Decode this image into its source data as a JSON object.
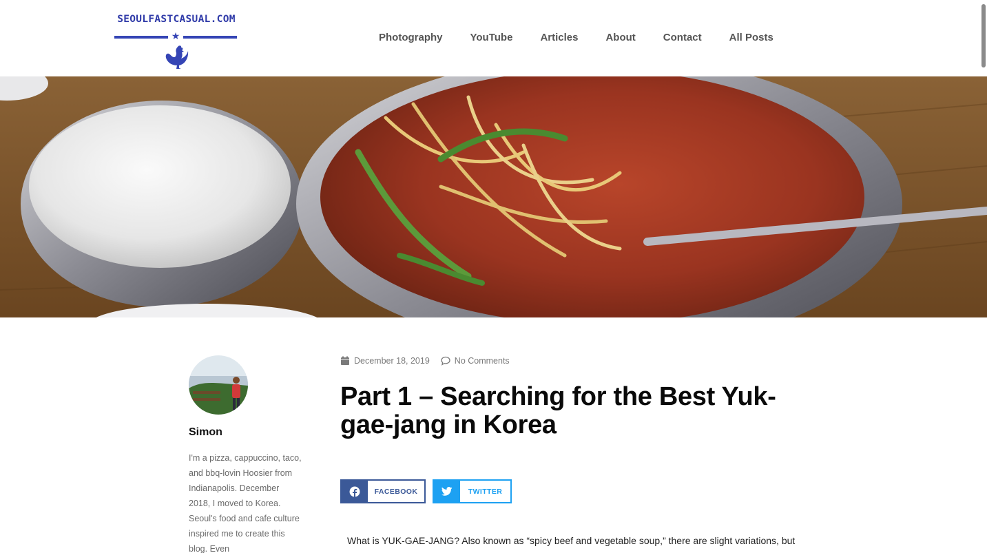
{
  "site": {
    "logo_text": "SEOULFASTCASUAL.COM",
    "brand_color": "#3545b5"
  },
  "nav": {
    "items": [
      {
        "label": "Photography"
      },
      {
        "label": "YouTube"
      },
      {
        "label": "Articles"
      },
      {
        "label": "About"
      },
      {
        "label": "Contact"
      },
      {
        "label": "All Posts"
      }
    ]
  },
  "author": {
    "name": "Simon",
    "bio": "I'm a pizza, cappuccino, taco, and bbq-lovin Hoosier from Indianapolis. December 2018, I moved to Korea. Seoul's food and cafe culture inspired me to create this blog. Even"
  },
  "post": {
    "date": "December 18, 2019",
    "comments": "No Comments",
    "title": "Part 1 – Searching for the Best Yuk-gae-jang in Korea",
    "intro": "What is YUK-GAE-JANG? Also known as “spicy beef and vegetable soup,” there are slight variations, but"
  },
  "share": {
    "facebook_label": "FACEBOOK",
    "twitter_label": "TWITTER",
    "facebook_color": "#3b5998",
    "twitter_color": "#1da1f2"
  },
  "icons": {
    "date": "calendar-icon",
    "comments": "comment-bubble-icon",
    "facebook": "facebook-icon",
    "twitter": "twitter-icon"
  }
}
